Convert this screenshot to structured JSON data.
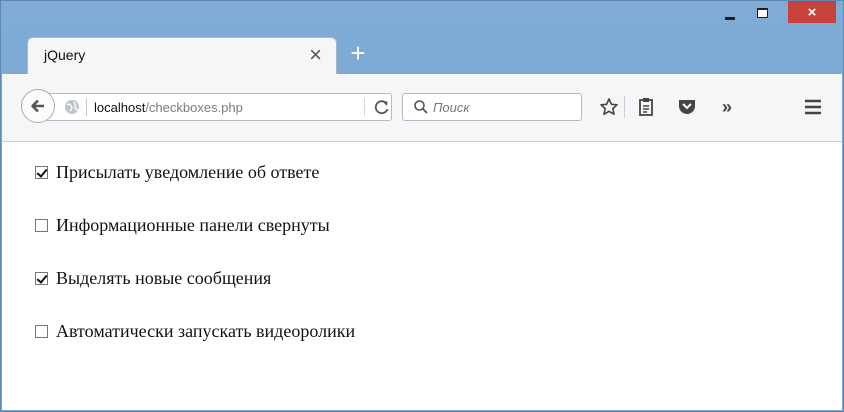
{
  "window": {
    "controls": {
      "minimize": "–",
      "maximize": "☐",
      "close": "×"
    }
  },
  "tab": {
    "title": "jQuery",
    "close": "×",
    "new_tab": "+"
  },
  "toolbar": {
    "url_host": "localhost",
    "url_path": "/checkboxes.php",
    "search_placeholder": "Поиск",
    "overflow": "»"
  },
  "options": [
    {
      "label": "Присылать уведомление об ответе",
      "checked": true
    },
    {
      "label": "Информационные панели свернуты",
      "checked": false
    },
    {
      "label": "Выделять новые сообщения",
      "checked": true
    },
    {
      "label": "Автоматически запускать видеоролики",
      "checked": false
    }
  ],
  "colors": {
    "frame": "#7aa7d3",
    "close": "#c7423b",
    "content": "#ffffff"
  }
}
